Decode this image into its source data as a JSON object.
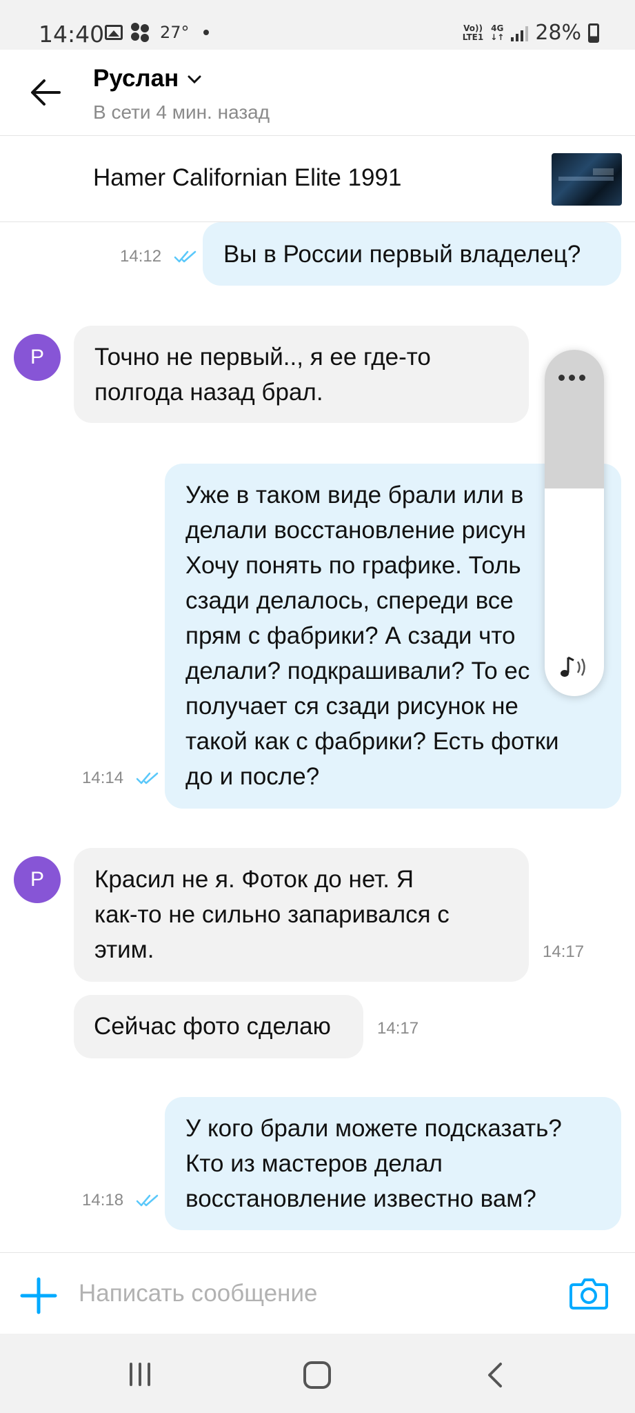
{
  "status_bar": {
    "time": "14:40",
    "temperature": "27°",
    "network_top": "Vo))",
    "network_bottom": "LTE1",
    "network_type": "4G",
    "battery": "28%"
  },
  "header": {
    "name": "Руслан",
    "status": "В сети 4 мин. назад"
  },
  "listing": {
    "title": "Hamer Californian Elite 1991"
  },
  "messages": [
    {
      "direction": "out",
      "time": "14:12",
      "lines": [
        "Вы в России первый владелец?"
      ]
    },
    {
      "direction": "in",
      "avatar": "Р",
      "lines": [
        "Точно не первый.., я ее где-то",
        "полгода назад брал."
      ]
    },
    {
      "direction": "out",
      "time": "14:14",
      "lines": [
        "Уже в таком виде брали или в",
        "делали восстановление рисун",
        "Хочу понять по графике. Толь",
        "сзади делалось, спереди все",
        "прям с фабрики? А сзади что",
        "делали? подкрашивали? То ес",
        "получает ся сзади рисунок не",
        "такой как с фабрики? Есть фотки",
        "до и после?"
      ]
    },
    {
      "direction": "in",
      "avatar": "Р",
      "time": "14:17",
      "lines": [
        "Красил не я. Фоток до нет. Я",
        "как-то не сильно запаривался с",
        "этим."
      ]
    },
    {
      "direction": "in",
      "time": "14:17",
      "lines": [
        "Сейчас фото сделаю"
      ]
    },
    {
      "direction": "out",
      "time": "14:18",
      "lines": [
        "У кого брали можете подсказать?",
        "Кто из мастеров делал",
        "восстановление известно вам?"
      ]
    }
  ],
  "volume_panel": {
    "level": 0.6
  },
  "composer": {
    "placeholder": "Написать сообщение"
  },
  "colors": {
    "accent": "#00aaff",
    "avatar": "#8755d6",
    "outgoing_bubble": "#e3f3fc",
    "incoming_bubble": "#f2f2f2",
    "read_ticks": "#5ac8fa"
  },
  "icons": {
    "back": "arrow-left-icon",
    "chevron": "chevron-down-icon",
    "add": "plus-icon",
    "camera": "camera-icon",
    "ticks": "double-check-icon",
    "sound": "music-volume-icon",
    "more": "more-dots-icon"
  }
}
